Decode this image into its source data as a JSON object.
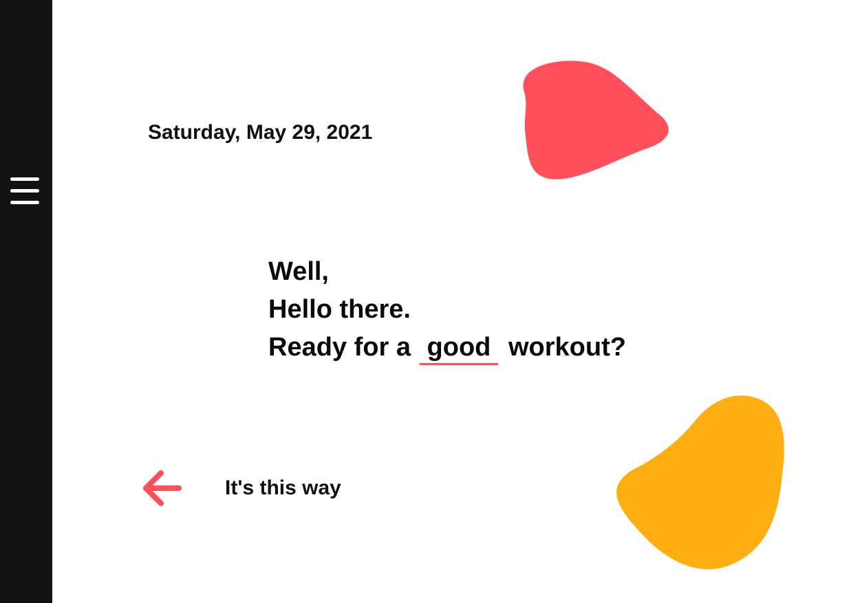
{
  "sidebar": {
    "menu_icon": "hamburger-menu-icon"
  },
  "header": {
    "date": "Saturday, May 29, 2021"
  },
  "greeting": {
    "line1": "Well,",
    "line2": "Hello there.",
    "line3_prefix": "Ready for a",
    "line3_highlight": "good",
    "line3_suffix": "workout?"
  },
  "direction": {
    "label": "It's this way",
    "icon": "arrow-left-icon"
  },
  "colors": {
    "sidebar": "#121212",
    "accent_red": "#ff4f5a",
    "accent_yellow": "#feae10",
    "text": "#111111",
    "background": "#ffffff"
  }
}
